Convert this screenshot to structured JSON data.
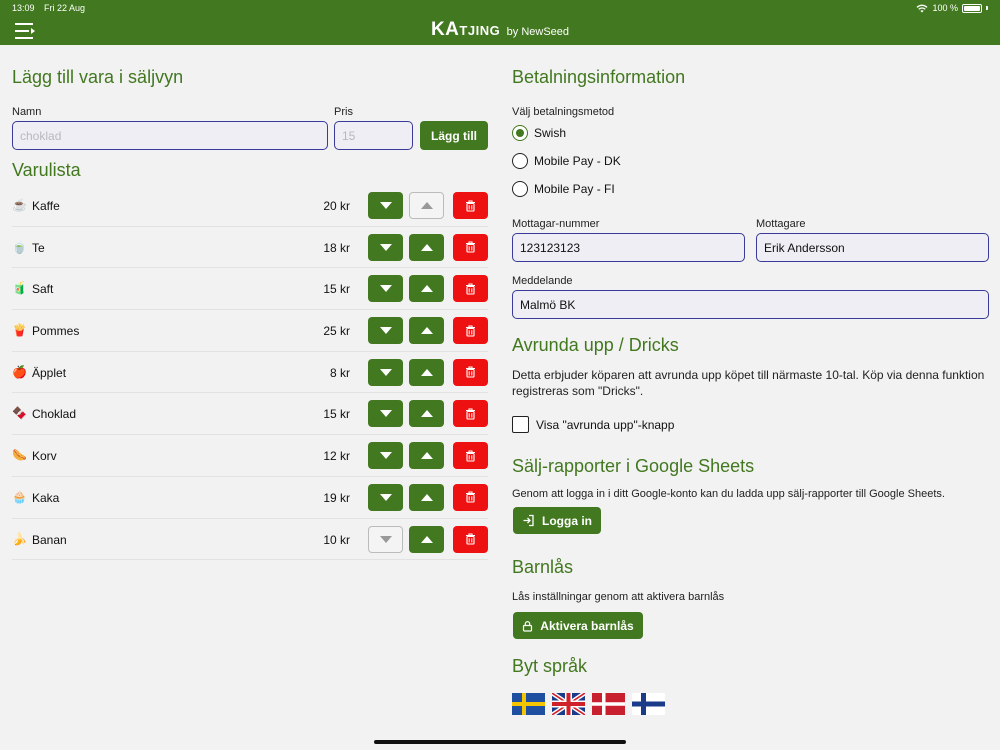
{
  "status_bar": {
    "time": "13:09",
    "date": "Fri 22 Aug",
    "battery": "100 %"
  },
  "header": {
    "logo_ka": "KA",
    "logo_tjing": "TJING",
    "logo_by": "by NewSeed"
  },
  "add_item": {
    "title": "Lägg till vara i säljvyn",
    "name_label": "Namn",
    "name_placeholder": "choklad",
    "price_label": "Pris",
    "price_placeholder": "15",
    "add_button": "Lägg till"
  },
  "item_list": {
    "title": "Varulista",
    "items": [
      {
        "emoji": "☕",
        "name": "Kaffe",
        "price": "20 kr",
        "down_enabled": true,
        "up_enabled": false
      },
      {
        "emoji": "🍵",
        "name": "Te",
        "price": "18 kr",
        "down_enabled": true,
        "up_enabled": true
      },
      {
        "emoji": "🧃",
        "name": "Saft",
        "price": "15 kr",
        "down_enabled": true,
        "up_enabled": true
      },
      {
        "emoji": "🍟",
        "name": "Pommes",
        "price": "25 kr",
        "down_enabled": true,
        "up_enabled": true
      },
      {
        "emoji": "🍎",
        "name": "Äpplet",
        "price": "8 kr",
        "down_enabled": true,
        "up_enabled": true
      },
      {
        "emoji": "🍫",
        "name": "Choklad",
        "price": "15 kr",
        "down_enabled": true,
        "up_enabled": true
      },
      {
        "emoji": "🌭",
        "name": "Korv",
        "price": "12 kr",
        "down_enabled": true,
        "up_enabled": true
      },
      {
        "emoji": "🧁",
        "name": "Kaka",
        "price": "19 kr",
        "down_enabled": true,
        "up_enabled": true
      },
      {
        "emoji": "🍌",
        "name": "Banan",
        "price": "10 kr",
        "down_enabled": false,
        "up_enabled": true
      }
    ]
  },
  "payment": {
    "title": "Betalningsinformation",
    "method_label": "Välj betalningsmetod",
    "methods": [
      "Swish",
      "Mobile Pay - DK",
      "Mobile Pay - FI"
    ],
    "selected_method": "Swish",
    "recipient_number_label": "Mottagar-nummer",
    "recipient_number_value": "123123123",
    "recipient_label": "Mottagare",
    "recipient_value": "Erik Andersson",
    "message_label": "Meddelande",
    "message_value": "Malmö BK"
  },
  "round_up": {
    "title": "Avrunda upp / Dricks",
    "description": "Detta erbjuder köparen att avrunda upp köpet till närmaste 10-tal. Köp via denna funktion registreras som \"Dricks\".",
    "checkbox_label": "Visa \"avrunda upp\"-knapp",
    "checked": false
  },
  "google_sheets": {
    "title": "Sälj-rapporter i Google Sheets",
    "description": "Genom att logga in i ditt Google-konto kan du ladda upp sälj-rapporter till Google Sheets.",
    "login_button": "Logga in"
  },
  "child_lock": {
    "title": "Barnlås",
    "description": "Lås inställningar genom att aktivera barnlås",
    "button": "Aktivera barnlås"
  },
  "language": {
    "title": "Byt språk",
    "flags": [
      "sweden-flag-icon",
      "uk-flag-icon",
      "denmark-flag-icon",
      "finland-flag-icon"
    ]
  },
  "colors": {
    "brand_green": "#42781f",
    "delete_red": "#ee1111",
    "input_border": "#3a3a9a"
  }
}
